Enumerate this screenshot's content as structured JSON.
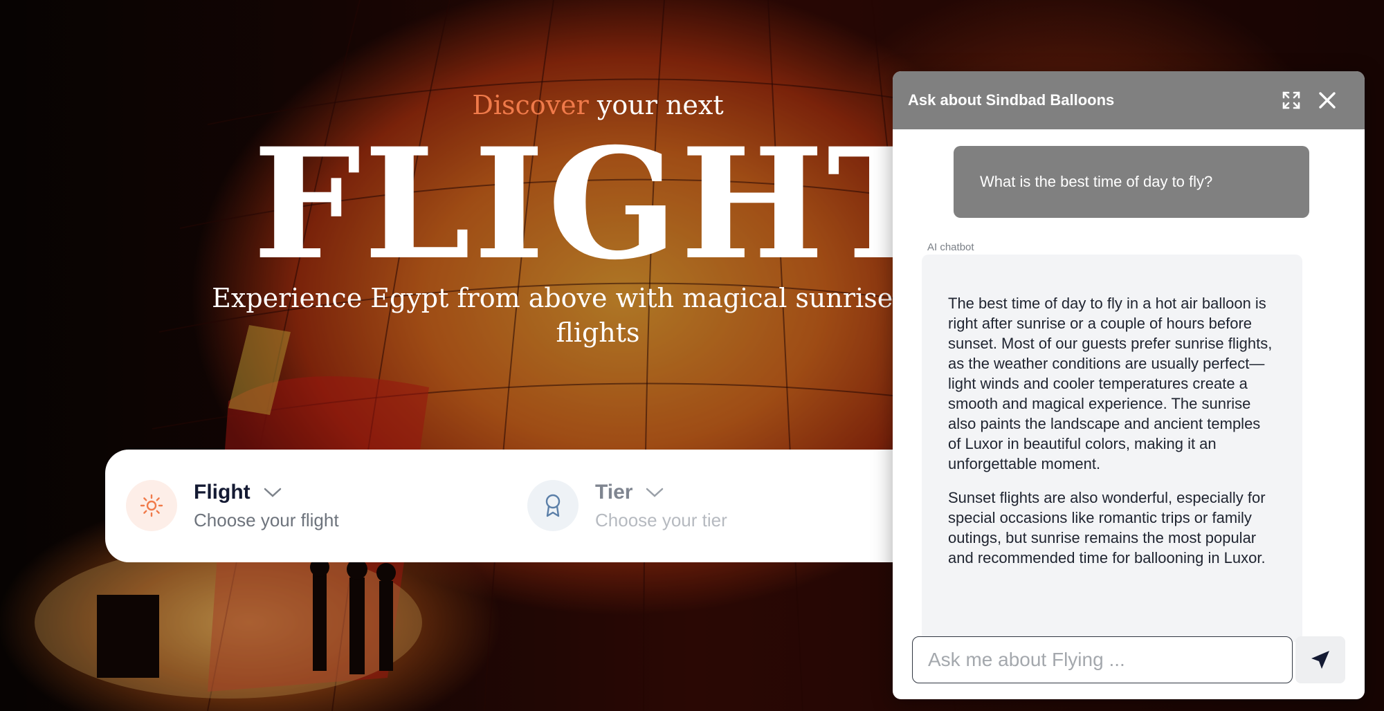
{
  "hero": {
    "discover_accent": "Discover",
    "discover_rest": "your next",
    "headline": "FLIGHT",
    "tagline_line1": "Experience Egypt from above with magical sunrise and m",
    "tagline_line2": "flights"
  },
  "search": {
    "flight_label": "Flight",
    "flight_placeholder": "Choose your flight",
    "flight_icon": "sun-icon",
    "tier_label": "Tier",
    "tier_placeholder": "Choose your tier",
    "tier_icon": "award-icon"
  },
  "chat": {
    "title": "Ask about Sindbad Balloons",
    "user_message": "What is the best time of day to fly?",
    "bot_label": "AI chatbot",
    "bot_paragraph_1": "The best time of day to fly in a hot air balloon is right after sunrise or a couple of hours before sunset. Most of our guests prefer sunrise flights, as the weather conditions are usually perfect—light winds and cooler temperatures create a smooth and magical experience. The sunrise also paints the landscape and ancient temples of Luxor in beautiful colors, making it an unforgettable moment.",
    "bot_paragraph_2": "Sunset flights are also wonderful, especially for special occasions like romantic trips or family outings, but sunrise remains the most popular and recommended time for ballooning in Luxor.",
    "input_placeholder": "Ask me about Flying ...",
    "icons": [
      "expand-icon",
      "close-icon",
      "send-icon"
    ]
  },
  "colors": {
    "accent": "#f07a4a",
    "chat_header": "#808080",
    "tier_icon": "#5b7fa8"
  }
}
